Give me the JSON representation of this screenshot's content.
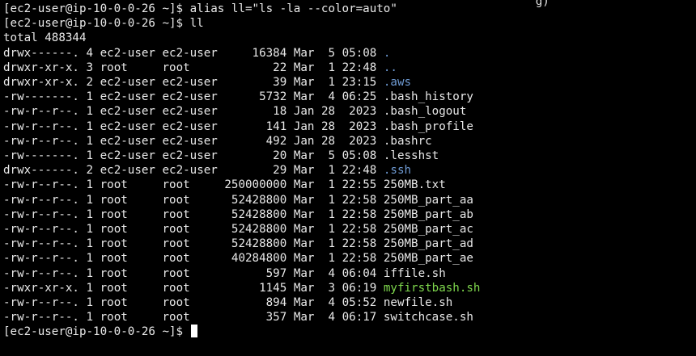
{
  "colors": {
    "background": "#000000",
    "text": "#e8e8e8",
    "directory": "#6f9bd4",
    "executable": "#7fd84d",
    "cursor": "#ffffff"
  },
  "cut_line": "                                                                             g) ",
  "prompt": "[ec2-user@ip-10-0-0-26 ~]$ ",
  "commands": {
    "alias": "alias ll=\"ls -la --color=auto\"",
    "ll": "ll"
  },
  "total": "total 488344",
  "listing": [
    {
      "perms": "drwx------.",
      "links": "4",
      "owner": "ec2-user",
      "group": "ec2-user",
      "size": "16384",
      "month": "Mar",
      "day": "5",
      "time": "05:08",
      "name": ".",
      "kind": "dir"
    },
    {
      "perms": "drwxr-xr-x.",
      "links": "3",
      "owner": "root",
      "group": "root",
      "size": "22",
      "month": "Mar",
      "day": "1",
      "time": "22:48",
      "name": "..",
      "kind": "dir"
    },
    {
      "perms": "drwxr-xr-x.",
      "links": "2",
      "owner": "ec2-user",
      "group": "ec2-user",
      "size": "39",
      "month": "Mar",
      "day": "1",
      "time": "23:15",
      "name": ".aws",
      "kind": "dir"
    },
    {
      "perms": "-rw-------.",
      "links": "1",
      "owner": "ec2-user",
      "group": "ec2-user",
      "size": "5732",
      "month": "Mar",
      "day": "4",
      "time": "06:25",
      "name": ".bash_history",
      "kind": "file"
    },
    {
      "perms": "-rw-r--r--.",
      "links": "1",
      "owner": "ec2-user",
      "group": "ec2-user",
      "size": "18",
      "month": "Jan",
      "day": "28",
      "time": "2023",
      "name": ".bash_logout",
      "kind": "file"
    },
    {
      "perms": "-rw-r--r--.",
      "links": "1",
      "owner": "ec2-user",
      "group": "ec2-user",
      "size": "141",
      "month": "Jan",
      "day": "28",
      "time": "2023",
      "name": ".bash_profile",
      "kind": "file"
    },
    {
      "perms": "-rw-r--r--.",
      "links": "1",
      "owner": "ec2-user",
      "group": "ec2-user",
      "size": "492",
      "month": "Jan",
      "day": "28",
      "time": "2023",
      "name": ".bashrc",
      "kind": "file"
    },
    {
      "perms": "-rw-------.",
      "links": "1",
      "owner": "ec2-user",
      "group": "ec2-user",
      "size": "20",
      "month": "Mar",
      "day": "5",
      "time": "05:08",
      "name": ".lesshst",
      "kind": "file"
    },
    {
      "perms": "drwx------.",
      "links": "2",
      "owner": "ec2-user",
      "group": "ec2-user",
      "size": "29",
      "month": "Mar",
      "day": "1",
      "time": "22:48",
      "name": ".ssh",
      "kind": "dir"
    },
    {
      "perms": "-rw-r--r--.",
      "links": "1",
      "owner": "root",
      "group": "root",
      "size": "250000000",
      "month": "Mar",
      "day": "1",
      "time": "22:55",
      "name": "250MB.txt",
      "kind": "file"
    },
    {
      "perms": "-rw-r--r--.",
      "links": "1",
      "owner": "root",
      "group": "root",
      "size": "52428800",
      "month": "Mar",
      "day": "1",
      "time": "22:58",
      "name": "250MB_part_aa",
      "kind": "file"
    },
    {
      "perms": "-rw-r--r--.",
      "links": "1",
      "owner": "root",
      "group": "root",
      "size": "52428800",
      "month": "Mar",
      "day": "1",
      "time": "22:58",
      "name": "250MB_part_ab",
      "kind": "file"
    },
    {
      "perms": "-rw-r--r--.",
      "links": "1",
      "owner": "root",
      "group": "root",
      "size": "52428800",
      "month": "Mar",
      "day": "1",
      "time": "22:58",
      "name": "250MB_part_ac",
      "kind": "file"
    },
    {
      "perms": "-rw-r--r--.",
      "links": "1",
      "owner": "root",
      "group": "root",
      "size": "52428800",
      "month": "Mar",
      "day": "1",
      "time": "22:58",
      "name": "250MB_part_ad",
      "kind": "file"
    },
    {
      "perms": "-rw-r--r--.",
      "links": "1",
      "owner": "root",
      "group": "root",
      "size": "40284800",
      "month": "Mar",
      "day": "1",
      "time": "22:58",
      "name": "250MB_part_ae",
      "kind": "file"
    },
    {
      "perms": "-rw-r--r--.",
      "links": "1",
      "owner": "root",
      "group": "root",
      "size": "597",
      "month": "Mar",
      "day": "4",
      "time": "06:04",
      "name": "iffile.sh",
      "kind": "file"
    },
    {
      "perms": "-rwxr-xr-x.",
      "links": "1",
      "owner": "root",
      "group": "root",
      "size": "1145",
      "month": "Mar",
      "day": "3",
      "time": "06:19",
      "name": "myfirstbash.sh",
      "kind": "exec"
    },
    {
      "perms": "-rw-r--r--.",
      "links": "1",
      "owner": "root",
      "group": "root",
      "size": "894",
      "month": "Mar",
      "day": "4",
      "time": "05:52",
      "name": "newfile.sh",
      "kind": "file"
    },
    {
      "perms": "-rw-r--r--.",
      "links": "1",
      "owner": "root",
      "group": "root",
      "size": "357",
      "month": "Mar",
      "day": "4",
      "time": "06:17",
      "name": "switchcase.sh",
      "kind": "file"
    }
  ]
}
